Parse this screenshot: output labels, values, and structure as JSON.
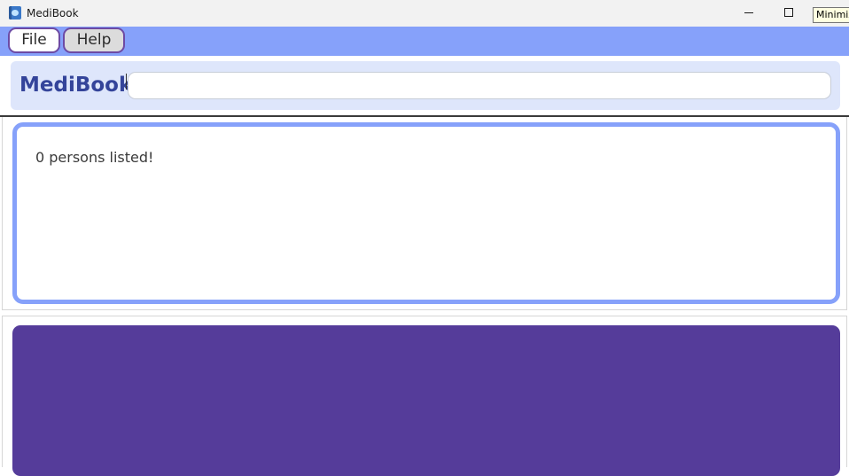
{
  "window": {
    "title": "MediBook",
    "tooltip": "Minimize"
  },
  "menu": {
    "file_label": "File",
    "help_label": "Help"
  },
  "command": {
    "brand": "MediBook",
    "input_value": "",
    "placeholder": ""
  },
  "result": {
    "message": "0 persons listed!"
  },
  "person_list": {
    "items": []
  },
  "colors": {
    "menubar": "#86a1fa",
    "accent_border": "#86a1fa",
    "brand_text": "#34449a",
    "command_panel": "#dee6fb",
    "list_panel": "#553c9a",
    "menu_button_border": "#6d4aa4"
  },
  "icons": {
    "app": "book-icon",
    "minimize": "minimize-icon",
    "maximize": "maximize-icon"
  }
}
